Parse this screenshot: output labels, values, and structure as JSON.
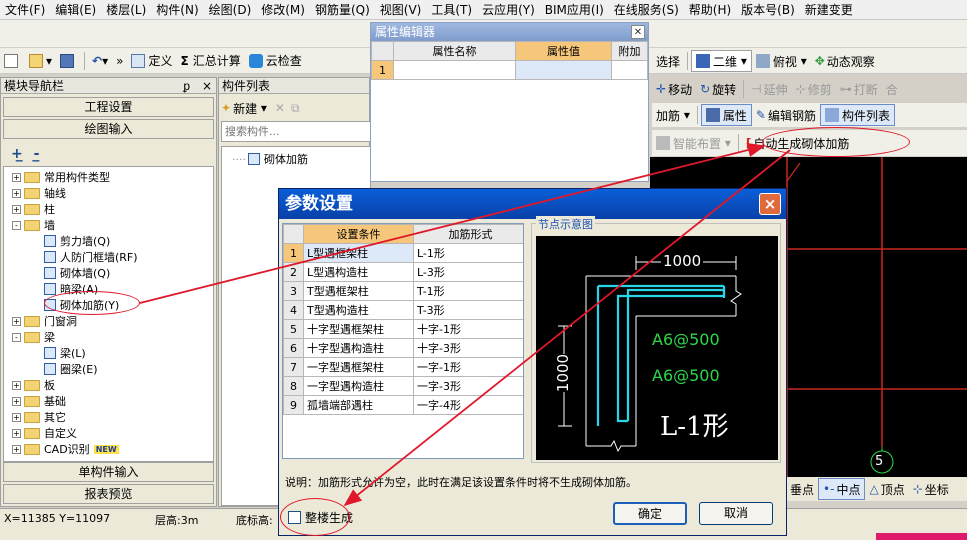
{
  "menu": [
    "文件(F)",
    "编辑(E)",
    "楼层(L)",
    "构件(N)",
    "绘图(D)",
    "修改(M)",
    "钢筋量(Q)",
    "视图(V)",
    "工具(T)",
    "云应用(Y)",
    "BIM应用(I)",
    "在线服务(S)",
    "帮助(H)",
    "版本号(B)",
    "新建变更"
  ],
  "toolbar": {
    "define": "定义",
    "sum": "汇总计算",
    "cloud_check": "云检查",
    "select": "选择",
    "view2d": "二维",
    "top_view": "俯视",
    "dynamic": "动态观察",
    "move": "移动",
    "rotate": "旋转",
    "extend": "延伸",
    "trim": "修剪",
    "break": "打断",
    "add_rebar": "加筋",
    "attribute": "属性",
    "edit_rebar": "编辑钢筋",
    "component_list": "构件列表",
    "smart_layout": "智能布置",
    "auto_gen": "自动生成砌体加筋",
    "new_label": "新建"
  },
  "nav": {
    "title": "模块导航栏",
    "pin": "ᵱ",
    "close": "×",
    "project_settings": "工程设置",
    "drawing_input": "绘图输入",
    "single_input": "单构件输入",
    "report_preview": "报表预览",
    "tree": [
      {
        "label": "常用构件类型",
        "depth": 0,
        "sign": "+",
        "type": "folder"
      },
      {
        "label": "轴线",
        "depth": 0,
        "sign": "+",
        "type": "folder"
      },
      {
        "label": "柱",
        "depth": 0,
        "sign": "+",
        "type": "folder"
      },
      {
        "label": "墙",
        "depth": 0,
        "sign": "-",
        "type": "folder"
      },
      {
        "label": "剪力墙(Q)",
        "depth": 1,
        "type": "leaf"
      },
      {
        "label": "人防门框墙(RF)",
        "depth": 1,
        "type": "leaf"
      },
      {
        "label": "砌体墙(Q)",
        "depth": 1,
        "type": "leaf"
      },
      {
        "label": "暗梁(A)",
        "depth": 1,
        "type": "leaf"
      },
      {
        "label": "砌体加筋(Y)",
        "depth": 1,
        "type": "leaf"
      },
      {
        "label": "门窗洞",
        "depth": 0,
        "sign": "+",
        "type": "folder"
      },
      {
        "label": "梁",
        "depth": 0,
        "sign": "-",
        "type": "folder"
      },
      {
        "label": "梁(L)",
        "depth": 1,
        "type": "leaf"
      },
      {
        "label": "圈梁(E)",
        "depth": 1,
        "type": "leaf"
      },
      {
        "label": "板",
        "depth": 0,
        "sign": "+",
        "type": "folder"
      },
      {
        "label": "基础",
        "depth": 0,
        "sign": "+",
        "type": "folder"
      },
      {
        "label": "其它",
        "depth": 0,
        "sign": "+",
        "type": "folder"
      },
      {
        "label": "自定义",
        "depth": 0,
        "sign": "+",
        "type": "folder"
      },
      {
        "label": "CAD识别",
        "depth": 0,
        "sign": "+",
        "type": "folder",
        "badge": "NEW"
      }
    ]
  },
  "comp_list": {
    "title": "构件列表",
    "search_placeholder": "搜索构件...",
    "items": [
      "砌体加筋"
    ]
  },
  "prop_editor": {
    "title": "属性编辑器",
    "columns": [
      "属性名称",
      "属性值",
      "附加"
    ],
    "row_num": "1"
  },
  "dialog": {
    "title": "参数设置",
    "close": "×",
    "columns": [
      "设置条件",
      "加筋形式"
    ],
    "rows": [
      [
        "L型遇框架柱",
        "L-1形"
      ],
      [
        "L型遇构造柱",
        "L-3形"
      ],
      [
        "T型遇框架柱",
        "T-1形"
      ],
      [
        "T型遇构造柱",
        "T-3形"
      ],
      [
        "十字型遇框架柱",
        "十字-1形"
      ],
      [
        "十字型遇构造柱",
        "十字-3形"
      ],
      [
        "一字型遇框架柱",
        "一字-1形"
      ],
      [
        "一字型遇构造柱",
        "一字-3形"
      ],
      [
        "孤墙端部遇柱",
        "一字-4形"
      ]
    ],
    "diagram_title": "节点示意图",
    "dim_top": "1000",
    "dim_left": "1000",
    "rebar1": "A6@500",
    "rebar2": "A6@500",
    "shape_name": "L-1形",
    "note": "说明：加筋形式允许为空，此时在满足该设置条件时将不生成砌体加筋。",
    "whole_floor": "整楼生成",
    "ok": "确定",
    "cancel": "取消"
  },
  "snap": {
    "perp": "垂点",
    "mid": "中点",
    "vertex": "顶点",
    "coord": "坐标"
  },
  "cad": {
    "axis_label": "5"
  },
  "status": {
    "coords": "X=11385 Y=11097",
    "floor_height": "层高:3m",
    "base_height": "底标高:"
  },
  "colors": {
    "accent": "#e0182a",
    "title_blue": "#0a5fd8",
    "selected_header": "#f6c77b",
    "cad_bg": "#000000",
    "cad_green": "#2bd84a",
    "cad_cyan": "#27d6e8"
  }
}
